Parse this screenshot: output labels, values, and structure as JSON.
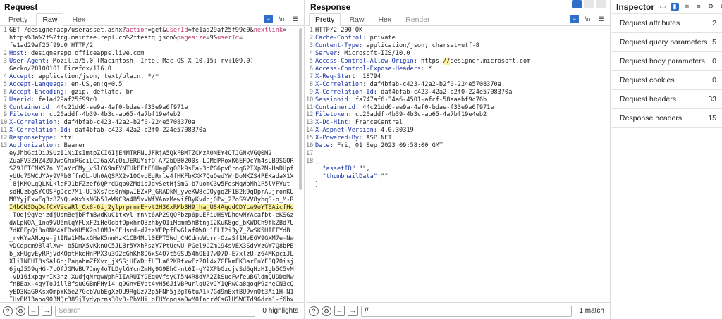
{
  "request": {
    "title": "Request",
    "tabs": [
      "Pretty",
      "Raw",
      "Hex"
    ],
    "active_tab": "Raw",
    "lines": [
      {
        "n": "1",
        "segments": [
          [
            "GET /designerapp/userasset.ashx?",
            ""
          ],
          [
            "action",
            "qparam"
          ],
          [
            "=get&",
            ""
          ],
          [
            "userId",
            "qparam"
          ],
          [
            "=fe1ad29af25f99c0&",
            ""
          ],
          [
            "nextlink",
            "qparam"
          ],
          [
            "=",
            ""
          ]
        ],
        "wraps": [
          [
            [
              "https%3a%2f%2frg.maintee.repl.co%2ftestq.json&",
              ""
            ],
            [
              "pagesize",
              "qparam"
            ],
            [
              "=9&",
              ""
            ],
            [
              "userId",
              "qparam"
            ],
            [
              "=",
              ""
            ]
          ],
          [
            [
              "fe1ad29af25f99c0 HTTP/2",
              ""
            ]
          ]
        ]
      },
      {
        "n": "2",
        "segments": [
          [
            "Host",
            "hname"
          ],
          [
            ": designerapp.officeapps.live.com",
            ""
          ]
        ]
      },
      {
        "n": "3",
        "segments": [
          [
            "User-Agent",
            "hname"
          ],
          [
            ": Mozilla/5.0 (Macintosh; Intel Mac OS X 10.15; rv:109.0)",
            ""
          ]
        ],
        "wraps": [
          [
            [
              "Gecko/20100101 Firefox/116.0",
              ""
            ]
          ]
        ]
      },
      {
        "n": "4",
        "segments": [
          [
            "Accept",
            "hname"
          ],
          [
            ": application/json, text/plain, */*",
            ""
          ]
        ]
      },
      {
        "n": "5",
        "segments": [
          [
            "Accept-Language",
            "hname"
          ],
          [
            ": en-US,en;q=0.5",
            ""
          ]
        ]
      },
      {
        "n": "6",
        "segments": [
          [
            "Accept-Encoding",
            "hname"
          ],
          [
            ": gzip, deflate, br",
            ""
          ]
        ]
      },
      {
        "n": "7",
        "segments": [
          [
            "Userid",
            "hname"
          ],
          [
            ": fe1ad29af25f99c0",
            ""
          ]
        ]
      },
      {
        "n": "8",
        "segments": [
          [
            "Containerid",
            "hname"
          ],
          [
            ": 44c21dd6-ee9a-4af0-bdae-f33e9a6f971e",
            ""
          ]
        ]
      },
      {
        "n": "9",
        "segments": [
          [
            "Filetoken",
            "hname"
          ],
          [
            ": cc20addf-4b39-4b3c-ab65-4a7bf19e4eb2",
            ""
          ]
        ]
      },
      {
        "n": "10",
        "segments": [
          [
            "X-Correlation",
            "hname"
          ],
          [
            ": daf4bfab-c423-42a2-b2f0-224e5708370a",
            ""
          ]
        ]
      },
      {
        "n": "11",
        "segments": [
          [
            "X-Correlation-Id",
            "hname"
          ],
          [
            ": daf4bfab-c423-42a2-b2f0-224e5708370a",
            ""
          ]
        ]
      },
      {
        "n": "12",
        "segments": [
          [
            "Responsetype",
            "hname"
          ],
          [
            ": html",
            ""
          ]
        ]
      },
      {
        "n": "13",
        "segments": [
          [
            "Authorization",
            "hname"
          ],
          [
            ": Bearer",
            ""
          ]
        ],
        "wraps": [
          [
            [
              "eyJhbGciOiJSUzI1NiIsImtpZCI6IjE4MTRFNUJFRjA5QkFBMTZCMzA0NEY4OTJGNkVGQ0M2",
              ""
            ]
          ],
          [
            [
              "ZuaFV3ZHZ4ZUJweGhxRGciLCJ6aXAiOiJERUYifQ.A72bDB0200s-LDMdPRoxK6EFDcYh4sLB9SGOR",
              ""
            ]
          ],
          [
            [
              "SZ9JETCMXS7nLYQaYrCMy_v5lC69mfYNTUkEEtE8UagPg0Pk9sEa-3oPG6pv8roqG2IXp2M-HsDUpf",
              ""
            ]
          ],
          [
            [
              "yUUc75WCUYAy9VPb0ffnGL-Uh0AQSPX2v1OCvdEgRrle4fHKFbKXK7QuQedYWrDoNKZS4PEKadaX1X",
              ""
            ]
          ],
          [
            [
              "_8jKMQLgQLKLkleFJ1bFZzef6QPrdDqb0ZMdisJdySetHjSmG_b7uomC3w5FesMqWbMh1P5lVFVut",
              ""
            ]
          ],
          [
            [
              "sdHUzbgSYCOSFgDcc7M1-UJ5Xs7cs0nWpwIEZxP_GRADkN_yveKW8cDQygq2P1B2k9qDprA.jronKU",
              ""
            ]
          ],
          [
            [
              "M8YyjExwFq3z8ZNQ.eXxYsNGb5JeWKCRa4B5vvWfVAnzMewifByKvdbj0Pw_2ZoS9VV8ybqS-o_M-R",
              ""
            ]
          ],
          [
            [
              "I4bCN3DqDcfCxVicaRl_Ox8-6ij2ylprprnmEHvt2H36xRMb3H9_ha_US4AqqdCDYLw9oYTEAicfHc",
              "hl"
            ]
          ],
          [
            [
              "_TOgj9gVejzdjUsmBejbPfmBwdKuC1txvl_mnNt6AP29QQFbzp6pLEFiUHSVDhgwNYAcafbt-eKSGz",
              ""
            ]
          ],
          [
            [
              "dWLpNOA_1no9VU6mlqYFUxF2iHeQobfOpxhrQBzhbyQIiMcmm5hBtnjI2KuK8gd_bKWDCh9fkZBd7U",
              ""
            ]
          ],
          [
            [
              "7dKEEpQi8n0NM4XFDvKU5K2n1OMJsCEHsrd-d7tzVFPpfFwGlaf0WOH1FLT2i3y7_ZwSK5HIFFYdB",
              ""
            ]
          ],
          [
            [
              "_rvKYaANoge-jtINe1kMaxGHeK5nmHzK1CB4Mul0EPT5Wd_CNCdmuWcrr-OzaSf1NvE6V9GXM7e-Nw",
              ""
            ]
          ],
          [
            [
              "yDCgpcm98l4lXwH_b5DmX5vKknOC5JLBr5VXhFszV7PtUcwU_PGel9CZm194sVEX3SdvVzGW7Q8bPE",
              ""
            ]
          ],
          [
            [
              "b_xHUgvEyRPjVdKOptHkdHnPPX3u3O2cGhKh8D6xS4O7t5GSU54hQE17wD7D-E7xlzU-z64MKpciJL",
              ""
            ]
          ],
          [
            [
              "XliINEUI8sSAlGqjPaqahmZfXvz_jXSSjUFWDHfLTLa62KRtxwEzZOl4xZGEkmFK3arFuYESQ70isj",
              ""
            ]
          ],
          [
            [
              "6jqJ559qHG-7cOfJGMvBU7Jmy4oTLDylGYcnZmHy9G9EhC-nt6I-gY9XPbGzojvSd6qHzHIgb5C5vM",
              ""
            ]
          ],
          [
            [
              "-vD16ixpqvrIK3nz_XudjqNrgwWphPIIARUIY9Eq0VfsyCT5N4R8dVA2ZkSucFwfeuBGldmQUDDoMw",
              ""
            ]
          ],
          [
            [
              "fnBEax-4gyToJillBfsuGGBmFHyi4_g9GnyEVqt4yH56JiVBPurlqU2vJY1QRwCa8goqP9zheCN3cQ",
              ""
            ]
          ],
          [
            [
              "yED3NaG0KsxOmpYK5eZ7GcbVubEgXzQU9RgUz72p5FNh5jZgT6tuA1k7Gd9mExfBU9vnOt3Ai1H-N1",
              ""
            ]
          ],
          [
            [
              "IUvEM13aoo903NQr38SjTydyprms30vO-PbYHi_oFHYqpgsaDwM0InorWCsGlUSWCTd96drm1-f6bx",
              ""
            ]
          ],
          [
            [
              "yy83gAyITtli7VUgZr8hcjFOs90_nTx_rIltZJzuha0BIigfsAehkA2tMNk1-M-TLqI2jAl2ubqI0A",
              ""
            ]
          ]
        ]
      }
    ],
    "search": {
      "placeholder": "Search",
      "value": "",
      "hits": "0 highlights"
    }
  },
  "response": {
    "title": "Response",
    "tabs": [
      "Pretty",
      "Raw",
      "Hex",
      "Render"
    ],
    "active_tab": "Pretty",
    "lines": [
      {
        "n": "1",
        "segments": [
          [
            "HTTP/2 200 OK",
            ""
          ]
        ]
      },
      {
        "n": "2",
        "segments": [
          [
            "Cache-Control",
            "hname"
          ],
          [
            ": private",
            ""
          ]
        ]
      },
      {
        "n": "3",
        "segments": [
          [
            "Content-Type",
            "hname"
          ],
          [
            ": application/json; charset=utf-8",
            ""
          ]
        ]
      },
      {
        "n": "4",
        "segments": [
          [
            "Server",
            "hname"
          ],
          [
            ": Microsoft-IIS/10.0",
            ""
          ]
        ]
      },
      {
        "n": "5",
        "segments": [
          [
            "Access-Control-Allow-Origin",
            "hname"
          ],
          [
            ": https:",
            ""
          ],
          [
            "//",
            "hl"
          ],
          [
            "designer.microsoft.com",
            ""
          ]
        ]
      },
      {
        "n": "6",
        "segments": [
          [
            "Access-Control-Expose-Headers",
            "hname"
          ],
          [
            ": *",
            ""
          ]
        ]
      },
      {
        "n": "7",
        "segments": [
          [
            "X-Req-Start",
            "hname"
          ],
          [
            ": 18794",
            ""
          ]
        ]
      },
      {
        "n": "8",
        "segments": [
          [
            "X-Correlation",
            "hname"
          ],
          [
            ": daf4bfab-c423-42a2-b2f0-224e5708370a",
            ""
          ]
        ]
      },
      {
        "n": "9",
        "segments": [
          [
            "X-Correlation-Id",
            "hname"
          ],
          [
            ": daf4bfab-c423-42a2-b2f0-224e5708370a",
            ""
          ]
        ]
      },
      {
        "n": "10",
        "segments": [
          [
            "Sessionid",
            "hname"
          ],
          [
            ": fa747af6-34a6-4501-afcf-58aaebf9c76b",
            ""
          ]
        ]
      },
      {
        "n": "11",
        "segments": [
          [
            "Containerid",
            "hname"
          ],
          [
            ": 44c21dd6-ee9a-4af0-bdae-f33e9a6f971e",
            ""
          ]
        ]
      },
      {
        "n": "12",
        "segments": [
          [
            "Filetoken",
            "hname"
          ],
          [
            ": cc20addf-4b39-4b3c-ab65-4a7bf19e4eb2",
            ""
          ]
        ]
      },
      {
        "n": "13",
        "segments": [
          [
            "X-Dc-Hint",
            "hname"
          ],
          [
            ": FranceCentral",
            ""
          ]
        ]
      },
      {
        "n": "14",
        "segments": [
          [
            "X-Aspnet-Version",
            "hname"
          ],
          [
            ": 4.0.30319",
            ""
          ]
        ]
      },
      {
        "n": "15",
        "segments": [
          [
            "X-Powered-By",
            "hname"
          ],
          [
            ": ASP.NET",
            ""
          ]
        ]
      },
      {
        "n": "16",
        "segments": [
          [
            "Date",
            "hname"
          ],
          [
            ": Fri, 01 Sep 2023 09:58:00 GMT",
            ""
          ]
        ]
      },
      {
        "n": "17",
        "segments": [
          [
            "",
            ""
          ]
        ]
      },
      {
        "n": "18",
        "segments": [
          [
            "{",
            ""
          ]
        ]
      },
      {
        "n": "",
        "segments": [
          [
            "  ",
            ""
          ],
          [
            "\"assetID\"",
            "hname"
          ],
          [
            ":\"\",",
            ""
          ]
        ]
      },
      {
        "n": "",
        "segments": [
          [
            "  ",
            ""
          ],
          [
            "\"thumbnailData\"",
            "hname"
          ],
          [
            ":\"\"",
            ""
          ]
        ]
      },
      {
        "n": "",
        "segments": [
          [
            "}",
            ""
          ]
        ]
      }
    ],
    "search": {
      "placeholder": "",
      "value": "//",
      "hits": "1 match"
    }
  },
  "inspector": {
    "title": "Inspector",
    "rows": [
      {
        "label": "Request attributes",
        "count": "2"
      },
      {
        "label": "Request query parameters",
        "count": "5"
      },
      {
        "label": "Request body parameters",
        "count": "0"
      },
      {
        "label": "Request cookies",
        "count": "0"
      },
      {
        "label": "Request headers",
        "count": "33"
      },
      {
        "label": "Response headers",
        "count": "15"
      }
    ]
  },
  "icons": {
    "help": "help-icon",
    "settings": "settings-icon",
    "back": "back-arrow-icon",
    "forward": "forward-arrow-icon"
  },
  "colors": {
    "accent": "#2f6fc9",
    "header_name": "#1b35a8",
    "query_param": "#c0306b",
    "highlight": "#fdf29a"
  }
}
